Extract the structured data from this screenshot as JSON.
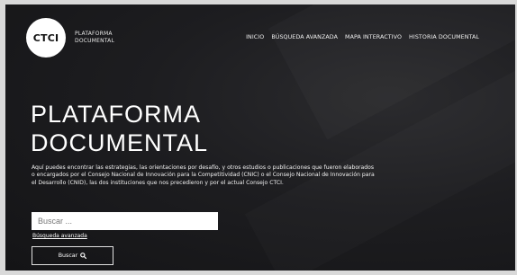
{
  "header": {
    "logo_text": "CTCI",
    "brand_line1": "PLATAFORMA",
    "brand_line2": "DOCUMENTAL",
    "nav": [
      {
        "label": "INICIO"
      },
      {
        "label": "BÚSQUEDA AVANZADA"
      },
      {
        "label": "MAPA INTERACTIVO"
      },
      {
        "label": "HISTORIA DOCUMENTAL"
      }
    ]
  },
  "hero": {
    "title_line1": "PLATAFORMA",
    "title_line2": "DOCUMENTAL",
    "description": "Aquí puedes encontrar las estrategias, las orientaciones por desafío, y otros estudios o publicaciones que fueron elaborados o encargados por el Consejo Nacional de Innovación para la Competitividad (CNIC) o el Consejo Nacional de Innovación para el Desarrollo (CNID), las dos instituciones que nos precedieron y por el actual Consejo CTCI."
  },
  "search": {
    "placeholder": "Buscar ...",
    "advanced_link": "Búsqueda avanzada",
    "button_label": "Buscar",
    "button_icon": "search-icon"
  },
  "colors": {
    "background": "#1d1d20",
    "text": "#ffffff",
    "logo_bg": "#ffffff"
  }
}
